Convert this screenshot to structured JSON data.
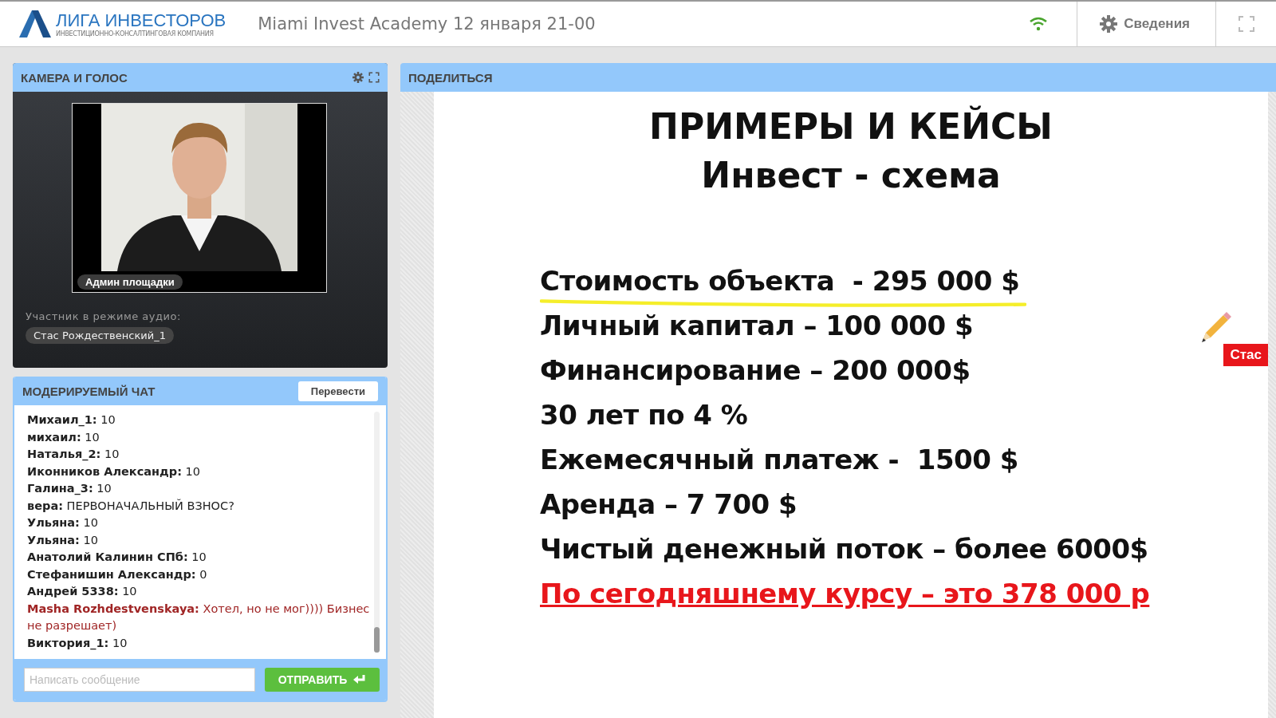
{
  "header": {
    "logo_title": "ЛИГА ИНВЕСТОРОВ",
    "logo_subtitle": "ИНВЕСТИЦИОННО-КОНСАЛТИНГОВАЯ КОМПАНИЯ",
    "event_title": "Miami Invest Academy 12 января 21-00",
    "info_button": "Сведения"
  },
  "camera_panel": {
    "title": "КАМЕРА И ГОЛОС",
    "video": {
      "kind": "picture",
      "caption": "Админ площадки"
    },
    "audio_label": "Участник в режиме аудио:",
    "audio_participants": [
      "Стас Рождественский_1"
    ]
  },
  "chat_panel": {
    "title": "МОДЕРИРУЕМЫЙ ЧАТ",
    "translate_button": "Перевести",
    "messages": [
      {
        "author": "Михаил_1:",
        "text": "10",
        "kind": "normal"
      },
      {
        "author": "михаил:",
        "text": "10",
        "kind": "normal"
      },
      {
        "author": "Наталья_2:",
        "text": "10",
        "kind": "normal"
      },
      {
        "author": "Иконников Александр:",
        "text": "10",
        "kind": "normal"
      },
      {
        "author": "Галина_3:",
        "text": "10",
        "kind": "normal"
      },
      {
        "author": "вера:",
        "text": "ПЕРВОНАЧАЛЬНЫЙ ВЗНОС?",
        "kind": "normal"
      },
      {
        "author": "Ульяна:",
        "text": "10",
        "kind": "normal"
      },
      {
        "author": "Ульяна:",
        "text": "10",
        "kind": "normal"
      },
      {
        "author": "Анатолий Калинин СПб:",
        "text": "10",
        "kind": "normal"
      },
      {
        "author": "Стефанишин Александр:",
        "text": "0",
        "kind": "normal"
      },
      {
        "author": "Андрей 5338:",
        "text": "10",
        "kind": "normal"
      },
      {
        "author": "Masha Rozhdestvenskaya:",
        "text": "Хотел, но не мог)))) Бизнес не разрешает)",
        "kind": "highlighted"
      },
      {
        "author": "Виктория_1:",
        "text": "10",
        "kind": "normal"
      }
    ],
    "input": {
      "placeholder": "Написать сообщение"
    },
    "send_button": "ОТПРАВИТЬ"
  },
  "share_panel": {
    "title": "ПОДЕЛИТЬСЯ",
    "slide": {
      "title": "ПРИМЕРЫ И КЕЙСЫ",
      "subtitle": "Инвест - схема",
      "lines": [
        {
          "text": "Стоимость объекта  - 295 000 $",
          "kind": "marked"
        },
        {
          "text": "Личный капитал – 100 000 $",
          "kind": "plain"
        },
        {
          "text": "Финансирование – 200 000$",
          "kind": "plain"
        },
        {
          "text": "30 лет по 4 %",
          "kind": "plain"
        },
        {
          "text": "Ежемесячный платеж -  1500 $",
          "kind": "plain"
        },
        {
          "text": "Аренда – 7 700 $",
          "kind": "plain"
        },
        {
          "text": "Чистый денежный поток – более 6000$",
          "kind": "plain"
        },
        {
          "text": "По сегодняшнему курсу – это 378 000 р",
          "kind": "alert"
        }
      ],
      "pointer_label": "Стас"
    }
  }
}
